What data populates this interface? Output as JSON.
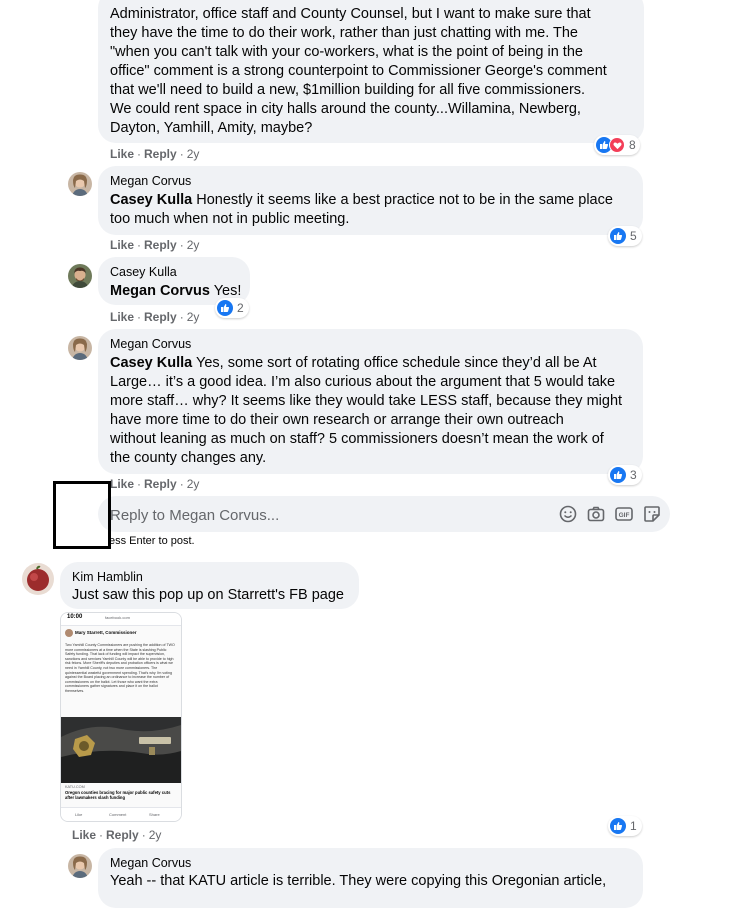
{
  "top_comment": {
    "lines": [
      "Administrator, office staff and County Counsel, but I want to make sure that",
      "they have the time to do their work, rather than just chatting with me. The",
      "\"when you can't talk with your co-workers, what is the point of being in the",
      "office\" comment is a strong counterpoint to Commissioner George's comment",
      "that we'll need to build a new, $1million building for all five commissioners.",
      "We could rent space in city halls around the county...Willamina, Newberg,",
      "Dayton, Yamhill, Amity, maybe?"
    ],
    "like": "Like",
    "reply": "Reply",
    "time": "2y",
    "reaction_count": "8"
  },
  "replies": [
    {
      "author": "Megan Corvus",
      "mention": "Casey Kulla",
      "lines": [
        " Honestly it seems like a best practice not to be in the same place",
        "too much when not in public meeting."
      ],
      "like": "Like",
      "reply": "Reply",
      "time": "2y",
      "reaction_count": "5"
    },
    {
      "author": "Casey Kulla",
      "mention": "Megan Corvus",
      "lines": [
        " Yes!"
      ],
      "like": "Like",
      "reply": "Reply",
      "time": "2y",
      "reaction_count": "2"
    },
    {
      "author": "Megan Corvus",
      "mention": "Casey Kulla",
      "lines": [
        " Yes, some sort of rotating office schedule since they’d all be At",
        "Large… it’s a good idea. I’m also curious about the argument that 5 would take",
        "more staff… why? It seems like they would take LESS staff, because they might",
        "have more time to do their own research or arrange their own outreach",
        "without leaning as much on staff? 5 commissioners doesn’t mean the work of",
        "the county changes any."
      ],
      "like": "Like",
      "reply": "Reply",
      "time": "2y",
      "reaction_count": "3"
    }
  ],
  "reply_box": {
    "placeholder": "Reply to Megan Corvus...",
    "hint": "ess Enter to post."
  },
  "kim_comment": {
    "author": "Kim Hamblin",
    "text": "Just saw this pop up on Starrett's FB page",
    "like": "Like",
    "reply": "Reply",
    "time": "2y",
    "reaction_count": "1"
  },
  "screenshot_thumb": {
    "time": "10:00",
    "url": "facebook.com",
    "poster": "Mary Starrett, Commissioner",
    "body": "Two Yamhill County Commissioners are pushing the addition of TWO more commissioners at a time when the State is slashing Public Safety funding. That lack of funding will impact the supervision, sanctions and services Yamhill County will be able to provide to high risk felons. More Sheriff's deputies and probation officers is what we need in Yamhill County, not two more commissioners. The quintessential wasteful government spending. That's why I'm voting against the Board placing an ordinance to increase the number of commissioners on the ballot. Let those who want the extra commissioners gather signatures and place it on the ballot themselves.",
    "link_source": "KATU.COM",
    "link_title": "Oregon counties bracing for major public safety cuts after lawmakers slash funding",
    "actions": [
      "Like",
      "Comment",
      "Share"
    ]
  },
  "bottom_reply": {
    "author": "Megan Corvus",
    "text": "Yeah -- that KATU article is terrible. They were copying this Oregonian article,"
  },
  "colors": {
    "bubble": "#f0f2f5",
    "like_blue": "#1877f2",
    "love_red": "#f33e58",
    "meta_gray": "#65676b"
  }
}
